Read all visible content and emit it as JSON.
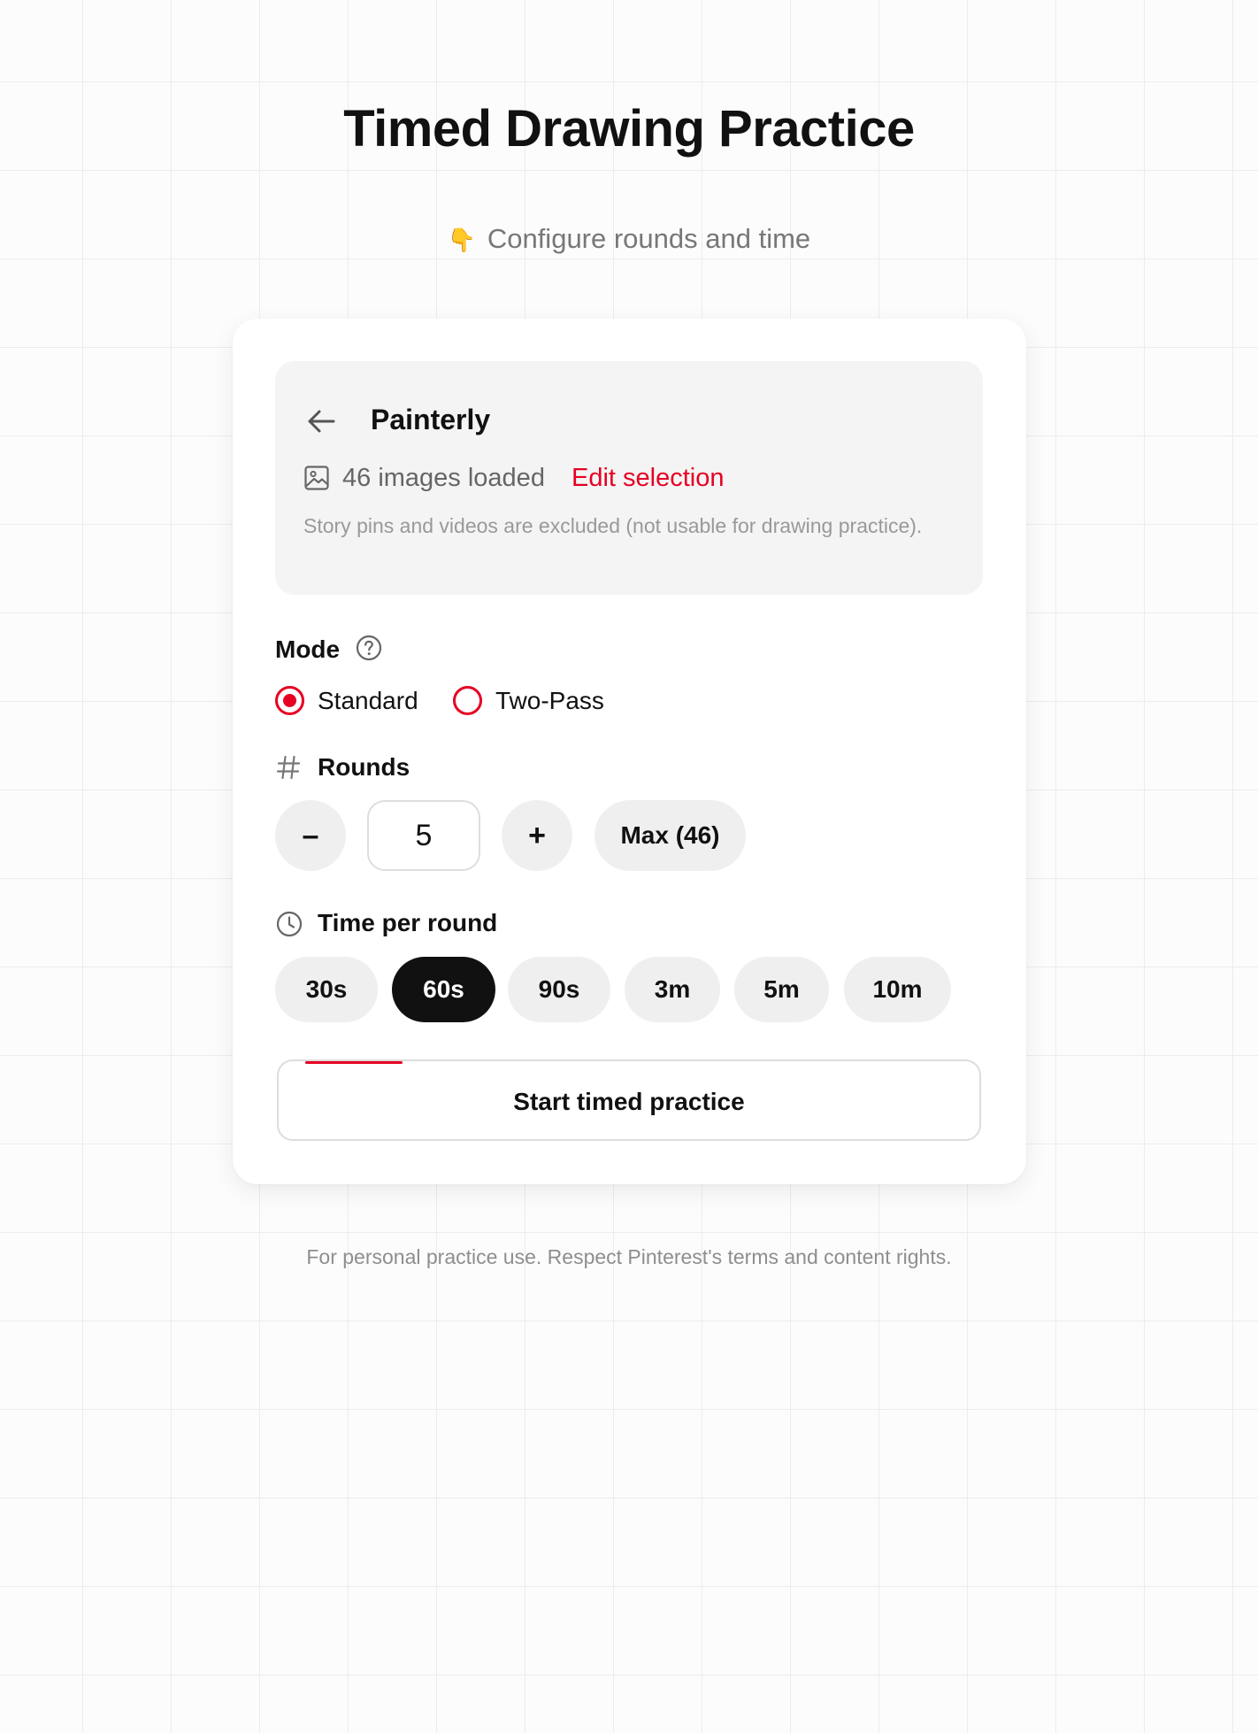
{
  "header": {
    "title": "Timed Drawing Practice",
    "subtitle_emoji": "👇",
    "subtitle": "Configure rounds and time"
  },
  "board": {
    "name": "Painterly",
    "images_loaded": "46 images loaded",
    "edit_selection": "Edit selection",
    "note": "Story pins and videos are excluded (not usable for drawing practice)."
  },
  "mode": {
    "label": "Mode",
    "options": [
      {
        "label": "Standard",
        "selected": true
      },
      {
        "label": "Two-Pass",
        "selected": false
      }
    ]
  },
  "rounds": {
    "label": "Rounds",
    "decrement": "–",
    "value": "5",
    "increment": "+",
    "max_label": "Max (46)"
  },
  "time": {
    "label": "Time per round",
    "options": [
      {
        "label": "30s",
        "selected": false
      },
      {
        "label": "60s",
        "selected": true
      },
      {
        "label": "90s",
        "selected": false
      },
      {
        "label": "3m",
        "selected": false
      },
      {
        "label": "5m",
        "selected": false
      },
      {
        "label": "10m",
        "selected": false
      }
    ]
  },
  "actions": {
    "start": "Start timed practice"
  },
  "footer": {
    "note": "For personal practice use. Respect Pinterest's terms and content rights."
  },
  "colors": {
    "accent": "#e60023",
    "selected_chip": "#111111",
    "chip_bg": "#efefef",
    "panel_bg": "#f4f4f4"
  },
  "icons": [
    "back-arrow-icon",
    "image-icon",
    "help-circle-icon",
    "hash-icon",
    "clock-icon"
  ]
}
